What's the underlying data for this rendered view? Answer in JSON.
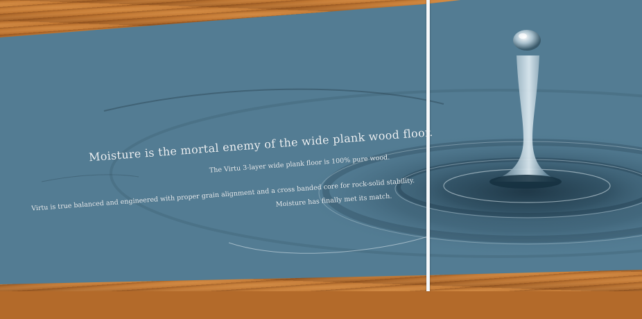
{
  "headline": "Moisture is the mortal enemy of the wide plank wood floor.",
  "lines": [
    "The Virtu 3-layer wide plank floor is 100% pure wood.",
    "Virtu is true balanced and engineered with proper grain alignment and a cross banded core for rock-solid stability.",
    "Moisture has finally met its match."
  ],
  "colors": {
    "panel": "#537c93",
    "wood": "#b36a2a",
    "text": "#eef3f6"
  }
}
